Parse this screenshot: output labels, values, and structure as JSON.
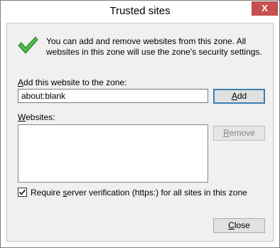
{
  "window": {
    "title": "Trusted sites",
    "close_glyph": "X"
  },
  "info": {
    "icon": "green-checkmark-icon",
    "text": "You can add and remove websites from this zone. All websites in this zone will use the zone's security settings."
  },
  "add_site": {
    "label_pre": "",
    "label_mnemonic": "A",
    "label_post": "dd this website to the zone:",
    "value": "about:blank",
    "button_mnemonic": "A",
    "button_post": "dd"
  },
  "websites": {
    "label_mnemonic": "W",
    "label_post": "ebsites:",
    "items": [],
    "remove_mnemonic": "R",
    "remove_post": "emove"
  },
  "verification": {
    "checked": true,
    "label_pre": "Require ",
    "label_mnemonic": "s",
    "label_post": "erver verification (https:) for all sites in this zone"
  },
  "footer": {
    "close_mnemonic": "C",
    "close_post": "lose"
  },
  "colors": {
    "close_button": "#c75050",
    "checkmark": "#3aa83a",
    "dialog_bg": "#f0f0f0"
  }
}
